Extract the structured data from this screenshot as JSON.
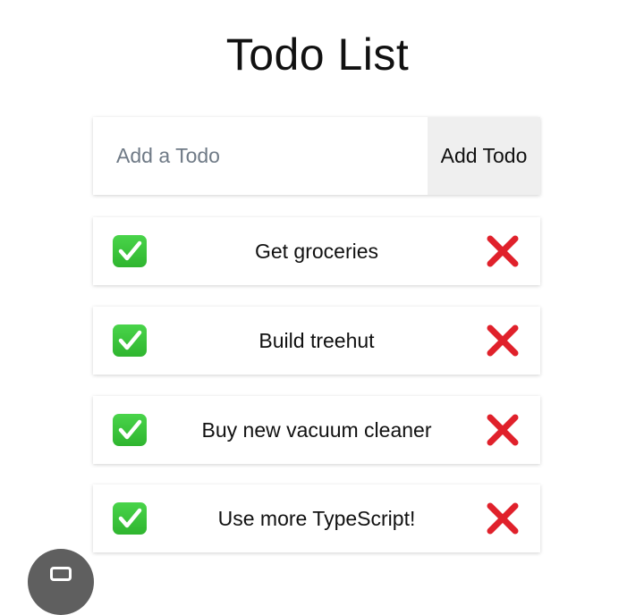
{
  "header": {
    "title": "Todo List"
  },
  "add_form": {
    "input_value": "",
    "input_placeholder": "Add a Todo",
    "button_label": "Add Todo"
  },
  "todos": [
    {
      "text": "Get groceries",
      "check_icon": "check-mark-button-icon",
      "delete_icon": "cross-mark-icon"
    },
    {
      "text": "Build treehut",
      "check_icon": "check-mark-button-icon",
      "delete_icon": "cross-mark-icon"
    },
    {
      "text": "Buy new vacuum cleaner",
      "check_icon": "check-mark-button-icon",
      "delete_icon": "cross-mark-icon"
    },
    {
      "text": "Use more TypeScript!",
      "check_icon": "check-mark-button-icon",
      "delete_icon": "cross-mark-icon"
    }
  ],
  "colors": {
    "check_green": "#3cc43c",
    "delete_red": "#e0212b",
    "button_bg": "#efefef",
    "placeholder": "#6f7a86"
  },
  "overlay": {
    "icon": "floating-action-icon"
  }
}
